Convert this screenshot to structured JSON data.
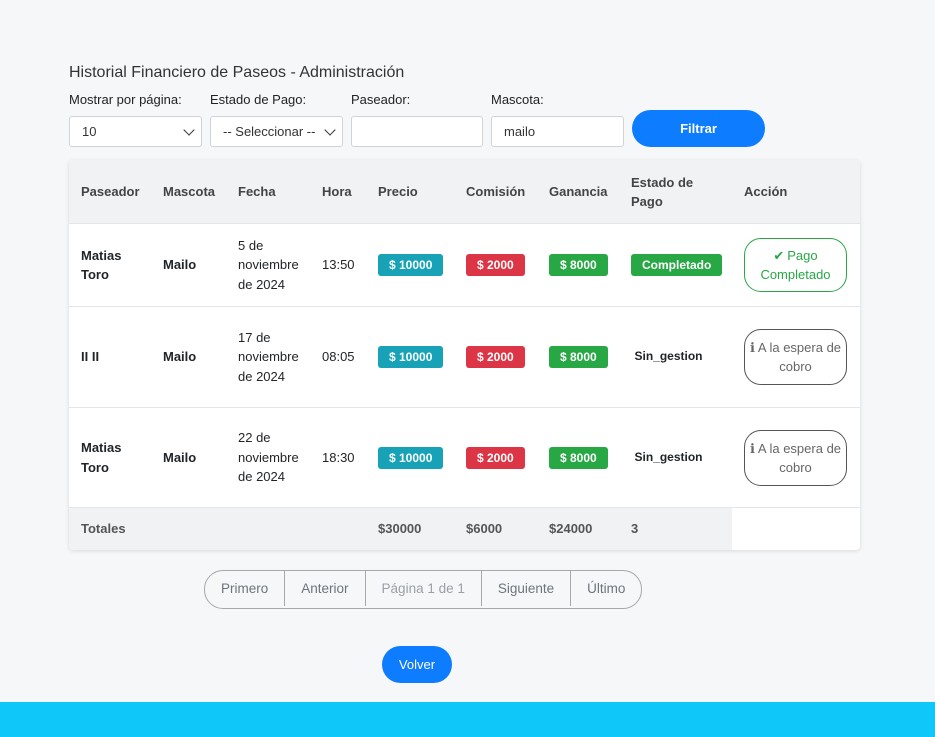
{
  "page": {
    "title": "Historial Financiero de Paseos - Administración"
  },
  "filters": {
    "per_page_label": "Mostrar por página:",
    "per_page_value": "10",
    "status_label": "Estado de Pago:",
    "status_value": "-- Seleccionar --",
    "walker_label": "Paseador:",
    "walker_value": "",
    "pet_label": "Mascota:",
    "pet_value": "mailo",
    "filter_button": "Filtrar"
  },
  "table": {
    "headers": [
      "Paseador",
      "Mascota",
      "Fecha",
      "Hora",
      "Precio",
      "Comisión",
      "Ganancia",
      "Estado de Pago",
      "Acción"
    ],
    "rows": [
      {
        "walker": "Matias Toro",
        "pet": "Mailo",
        "date": "5 de noviembre de 2024",
        "time": "13:50",
        "price": "$ 10000",
        "commission": "$ 2000",
        "earning": "$ 8000",
        "status": "Completado",
        "action": "Pago Completado",
        "action_icon": "check-double-icon"
      },
      {
        "walker": "II II",
        "pet": "Mailo",
        "date": "17 de noviembre de 2024",
        "time": "08:05",
        "price": "$ 10000",
        "commission": "$ 2000",
        "earning": "$ 8000",
        "status": "Sin_gestion",
        "action": "A la espera de cobro",
        "action_icon": "info-icon"
      },
      {
        "walker": "Matias Toro",
        "pet": "Mailo",
        "date": "22 de noviembre de 2024",
        "time": "18:30",
        "price": "$ 10000",
        "commission": "$ 2000",
        "earning": "$ 8000",
        "status": "Sin_gestion",
        "action": "A la espera de cobro",
        "action_icon": "info-icon"
      }
    ],
    "totals": {
      "label": "Totales",
      "price": "$30000",
      "commission": "$6000",
      "earning": "$24000",
      "count": "3"
    }
  },
  "pagination": {
    "first": "Primero",
    "prev": "Anterior",
    "current": "Página 1 de 1",
    "next": "Siguiente",
    "last": "Último"
  },
  "back_button": "Volver",
  "colors": {
    "primary": "#0d7cff",
    "info": "#17a2b8",
    "danger": "#dc3545",
    "success": "#28a745",
    "footer": "#0fc7f8"
  }
}
